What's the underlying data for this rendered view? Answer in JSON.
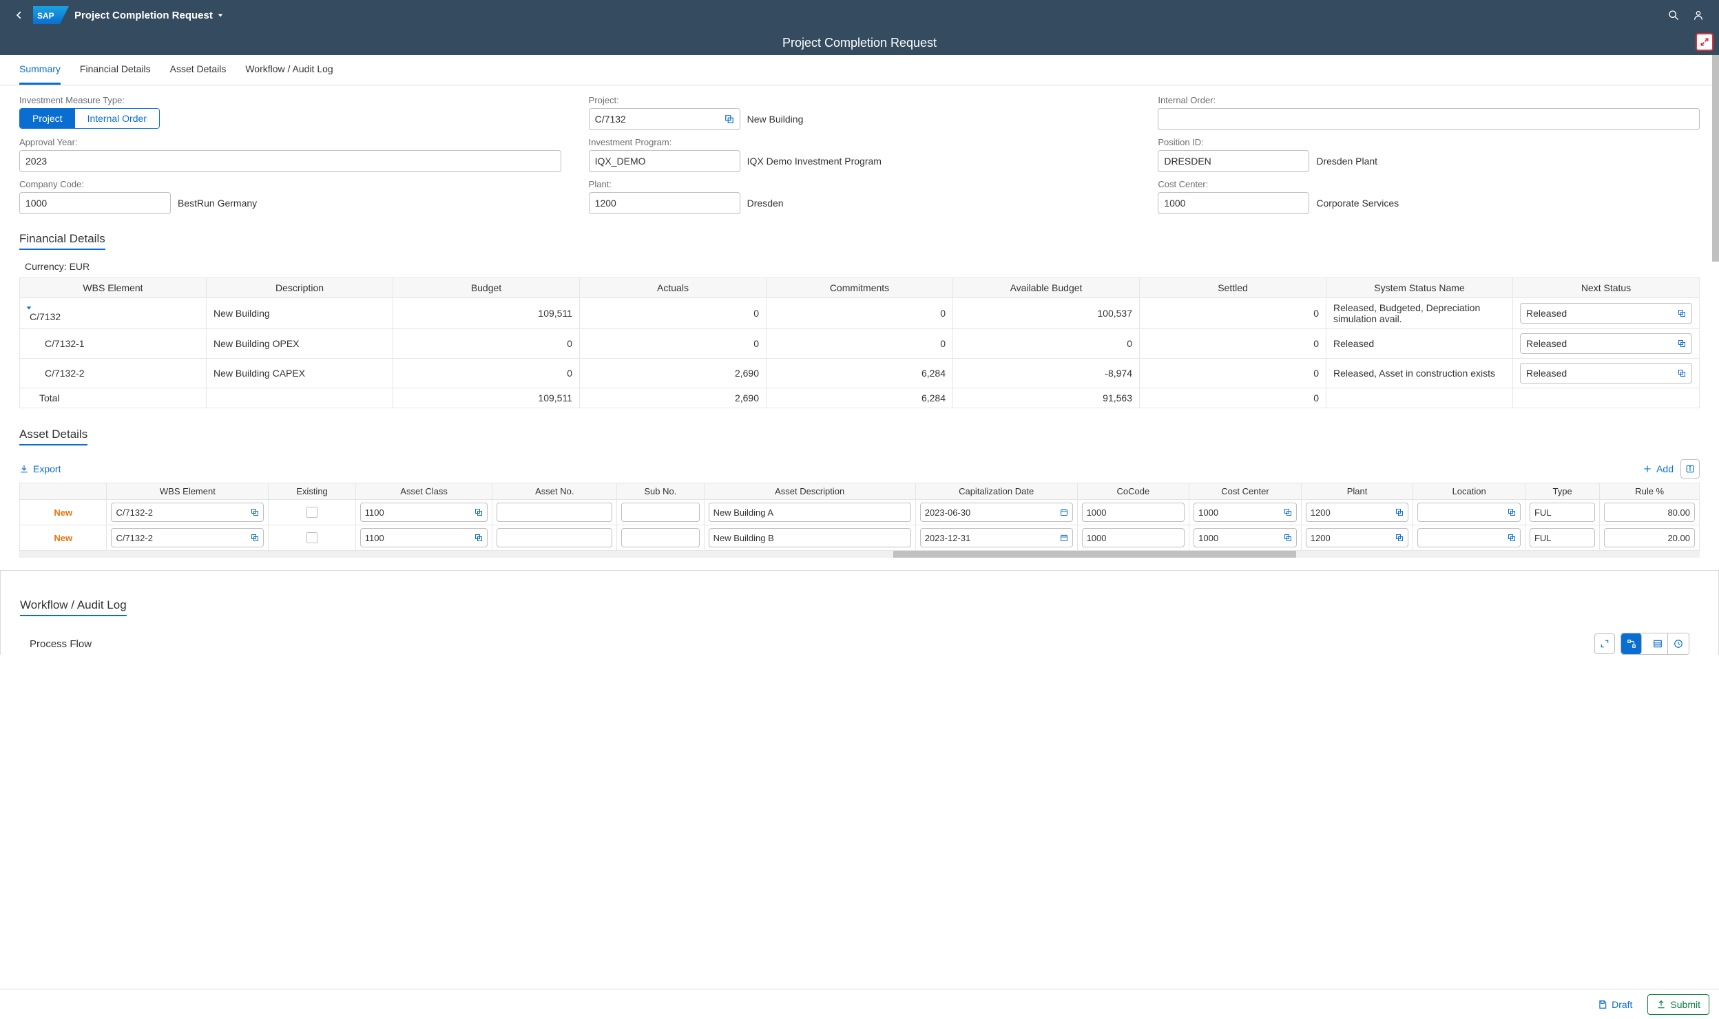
{
  "shell": {
    "title": "Project Completion Request",
    "page_title": "Project Completion Request"
  },
  "tabs": [
    {
      "label": "Summary",
      "active": true
    },
    {
      "label": "Financial Details",
      "active": false
    },
    {
      "label": "Asset Details",
      "active": false
    },
    {
      "label": "Workflow / Audit Log",
      "active": false
    }
  ],
  "general": {
    "inv_measure_type_label": "Investment Measure Type:",
    "seg_project": "Project",
    "seg_internal_order": "Internal Order",
    "project_label": "Project:",
    "project_value": "C/7132",
    "project_desc": "New Building",
    "internal_order_label": "Internal Order:",
    "internal_order_value": "",
    "approval_year_label": "Approval Year:",
    "approval_year_value": "2023",
    "inv_program_label": "Investment Program:",
    "inv_program_value": "IQX_DEMO",
    "inv_program_desc": "IQX Demo Investment Program",
    "position_id_label": "Position ID:",
    "position_id_value": "DRESDEN",
    "position_id_desc": "Dresden Plant",
    "company_code_label": "Company Code:",
    "company_code_value": "1000",
    "company_code_desc": "BestRun Germany",
    "plant_label": "Plant:",
    "plant_value": "1200",
    "plant_desc": "Dresden",
    "cost_center_label": "Cost Center:",
    "cost_center_value": "1000",
    "cost_center_desc": "Corporate Services"
  },
  "financial": {
    "section_title": "Financial Details",
    "currency_label": "Currency: EUR",
    "columns": [
      "WBS Element",
      "Description",
      "Budget",
      "Actuals",
      "Commitments",
      "Available Budget",
      "Settled",
      "System Status Name",
      "Next Status"
    ],
    "rows": [
      {
        "wbs": "C/7132",
        "desc": "New Building",
        "budget": "109,511",
        "actuals": "0",
        "commit": "0",
        "avail": "100,537",
        "settled": "0",
        "status": "Released, Budgeted, Depreciation simulation avail.",
        "next": "Released",
        "level": 0
      },
      {
        "wbs": "C/7132-1",
        "desc": "New Building OPEX",
        "budget": "0",
        "actuals": "0",
        "commit": "0",
        "avail": "0",
        "settled": "0",
        "status": "Released",
        "next": "Released",
        "level": 1
      },
      {
        "wbs": "C/7132-2",
        "desc": "New Building CAPEX",
        "budget": "0",
        "actuals": "2,690",
        "commit": "6,284",
        "avail": "-8,974",
        "settled": "0",
        "status": "Released, Asset in construction exists",
        "next": "Released",
        "level": 1
      }
    ],
    "total_label": "Total",
    "totals": {
      "budget": "109,511",
      "actuals": "2,690",
      "commit": "6,284",
      "avail": "91,563",
      "settled": "0"
    }
  },
  "assets": {
    "section_title": "Asset Details",
    "export_label": "Export",
    "add_label": "Add",
    "columns": [
      "",
      "WBS Element",
      "Existing",
      "Asset Class",
      "Asset No.",
      "Sub No.",
      "Asset Description",
      "Capitalization Date",
      "CoCode",
      "Cost Center",
      "Plant",
      "Location",
      "Type",
      "Rule %"
    ],
    "rows": [
      {
        "status": "New",
        "wbs": "C/7132-2",
        "existing": false,
        "asset_class": "1100",
        "asset_no": "",
        "sub_no": "",
        "desc": "New Building A",
        "cap_date": "2023-06-30",
        "cocode": "1000",
        "cost_center": "1000",
        "plant": "1200",
        "location": "",
        "type": "FUL",
        "rule": "80.00"
      },
      {
        "status": "New",
        "wbs": "C/7132-2",
        "existing": false,
        "asset_class": "1100",
        "asset_no": "",
        "sub_no": "",
        "desc": "New Building B",
        "cap_date": "2023-12-31",
        "cocode": "1000",
        "cost_center": "1000",
        "plant": "1200",
        "location": "",
        "type": "FUL",
        "rule": "20.00"
      }
    ]
  },
  "workflow": {
    "section_title": "Workflow / Audit Log",
    "process_flow_title": "Process Flow"
  },
  "footer": {
    "draft": "Draft",
    "submit": "Submit"
  }
}
